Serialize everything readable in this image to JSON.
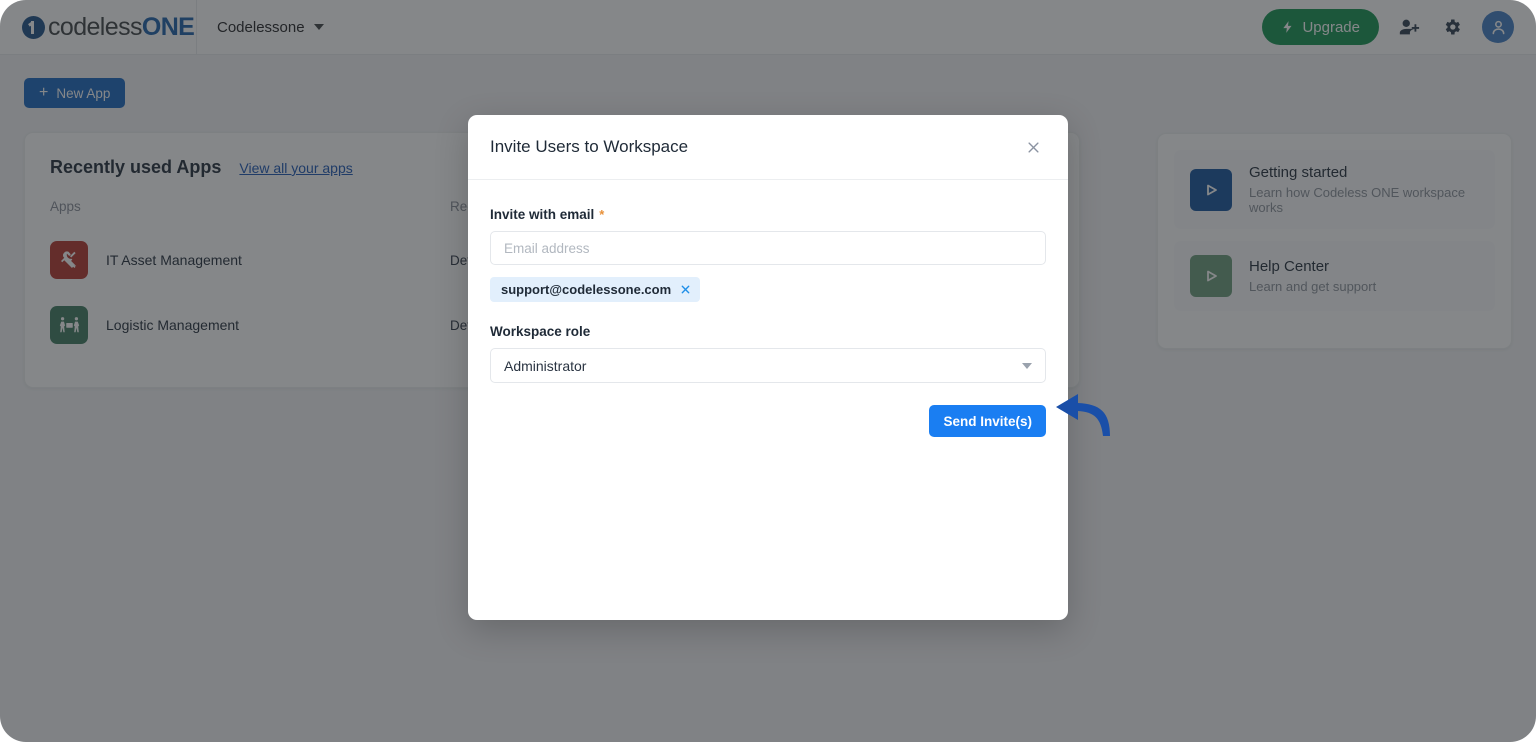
{
  "topbar": {
    "logo_primary": "codeless",
    "logo_accent": "ONE",
    "workspace_name": "Codelessone",
    "upgrade_label": "Upgrade",
    "upgrade_color": "#10924f",
    "icons": {
      "bolt": "bolt-icon",
      "add_user": "add-user-icon",
      "settings": "gear-icon",
      "avatar": "user-avatar-icon",
      "caret": "chevron-down-icon"
    }
  },
  "page": {
    "new_app_label": "New App",
    "new_app_color": "#1565c0",
    "apps_card": {
      "title": "Recently used Apps",
      "view_all_label": "View all your apps",
      "columns": [
        "Apps",
        "Recent"
      ],
      "rows": [
        {
          "name": "IT Asset Management",
          "recent": "Default",
          "icon": "tools-icon",
          "color": "#b5342a"
        },
        {
          "name": "Logistic Management",
          "recent": "Default",
          "icon": "logistics-people-icon",
          "color": "#3c7a5e"
        }
      ]
    },
    "side_card": {
      "items": [
        {
          "title": "Getting started",
          "subtitle": "Learn how Codeless ONE workspace works",
          "icon": "play-icon",
          "color": "#12509b"
        },
        {
          "title": "Help Center",
          "subtitle": "Learn and get support",
          "icon": "play-icon",
          "color": "#6a9b79"
        }
      ]
    }
  },
  "modal": {
    "title": "Invite Users to Workspace",
    "close_icon": "close-icon",
    "email_label": "Invite with email",
    "required_marker": "*",
    "email_placeholder": "Email address",
    "email_value": "",
    "chips": [
      {
        "label": "support@codelessone.com",
        "remove_icon": "close-icon"
      }
    ],
    "role_label": "Workspace role",
    "role_value": "Administrator",
    "role_caret": "chevron-down-icon",
    "send_label": "Send Invite(s)",
    "send_color": "#1a7ef2"
  },
  "annotation": {
    "arrow_color": "#1a4fa8",
    "arrow_name": "pointer-arrow"
  }
}
